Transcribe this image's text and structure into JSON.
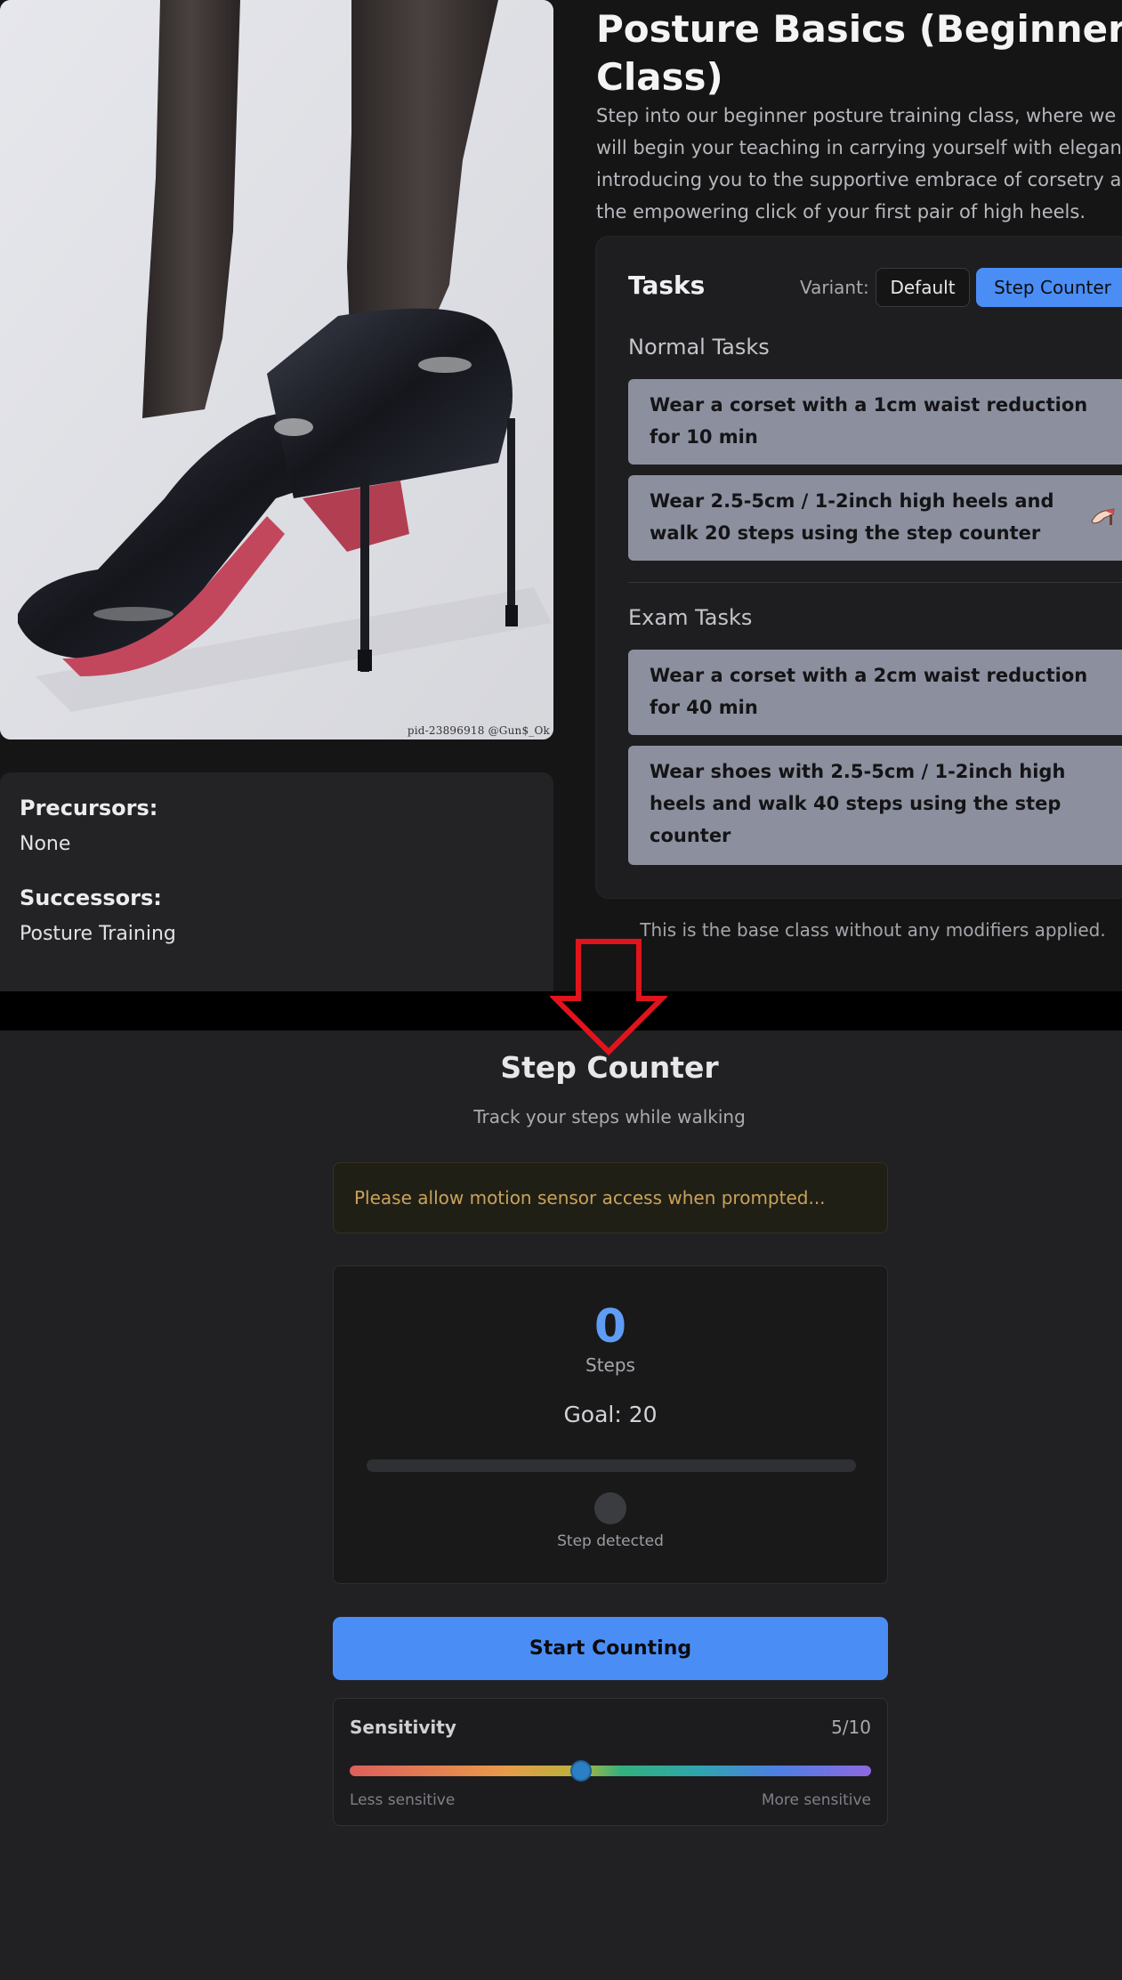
{
  "image": {
    "watermark": "pid-23896918   @Gun$_Ok"
  },
  "relations": {
    "precursors_label": "Precursors:",
    "precursors_value": "None",
    "successors_label": "Successors:",
    "successors_value": "Posture Training"
  },
  "class": {
    "title": "Posture Basics (Beginner Class)",
    "description_lines": [
      "Step into our beginner posture training class, where we",
      "will begin your teaching in carrying yourself with elegan",
      "introducing you to the supportive embrace of corsetry a",
      "the empowering click of your first pair of high heels."
    ],
    "base_note": "This is the base class without any modifiers applied."
  },
  "tasks": {
    "title": "Tasks",
    "variant_label": "Variant:",
    "variants": [
      "Default",
      "Step Counter"
    ],
    "selected_variant": "Step Counter",
    "normal_title": "Normal Tasks",
    "normal": [
      "Wear a corset with a 1cm waist reduction for 10 min",
      "Wear 2.5-5cm / 1-2inch high heels and walk 20 steps using the step counter"
    ],
    "exam_title": "Exam Tasks",
    "exam": [
      "Wear a corset with a 2cm waist reduction for 40 min",
      "Wear shoes with 2.5-5cm / 1-2inch high heels and walk 40 steps using the step counter"
    ],
    "task_icon": "high-heel-icon"
  },
  "step_counter": {
    "title": "Step Counter",
    "subtitle": "Track your steps while walking",
    "alert": "Please allow motion sensor access when prompted...",
    "count": "0",
    "count_label": "Steps",
    "goal": "Goal: 20",
    "progress": 0,
    "step_detected": "Step detected",
    "start_button": "Start Counting",
    "sensitivity_label": "Sensitivity",
    "sensitivity_value": "5/10",
    "sensitivity": 5,
    "sensitivity_max": 10,
    "less_label": "Less sensitive",
    "more_label": "More sensitive"
  },
  "colors": {
    "accent": "#4a8ef5",
    "annotation_arrow": "#e0141c"
  }
}
